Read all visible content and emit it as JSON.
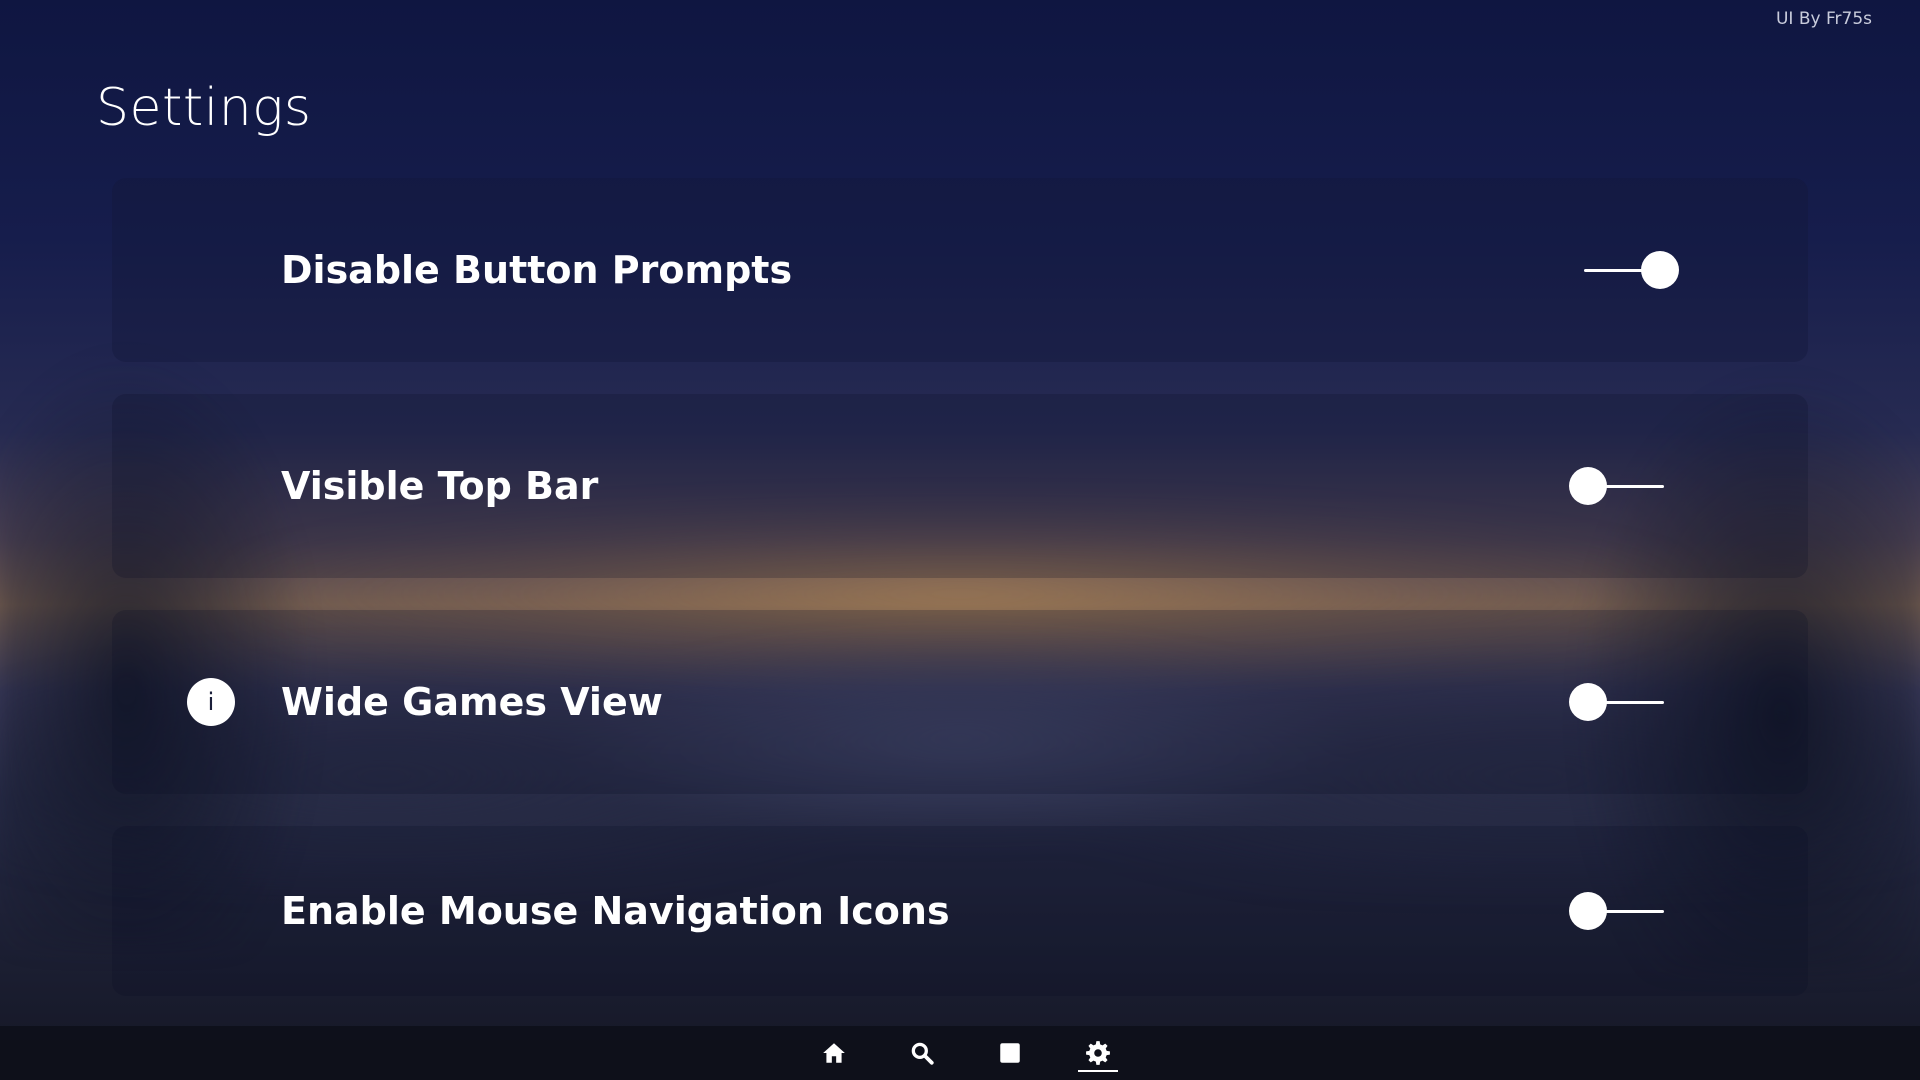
{
  "credit": "UI By Fr75s",
  "page_title": "Settings",
  "settings": [
    {
      "label": "Disable Button Prompts",
      "enabled": true,
      "has_info": false,
      "selected": true
    },
    {
      "label": "Visible Top Bar",
      "enabled": false,
      "has_info": false,
      "selected": false
    },
    {
      "label": "Wide Games View",
      "enabled": false,
      "has_info": true,
      "selected": false
    },
    {
      "label": "Enable Mouse Navigation Icons",
      "enabled": false,
      "has_info": false,
      "selected": false
    }
  ],
  "info_glyph": "i",
  "nav": {
    "items": [
      {
        "icon": "home-icon",
        "active": false
      },
      {
        "icon": "search-icon",
        "active": false
      },
      {
        "icon": "library-icon",
        "active": false
      },
      {
        "icon": "gear-icon",
        "active": true
      }
    ]
  },
  "colors": {
    "text": "#ffffff",
    "nav_bar": "#0e101a"
  }
}
